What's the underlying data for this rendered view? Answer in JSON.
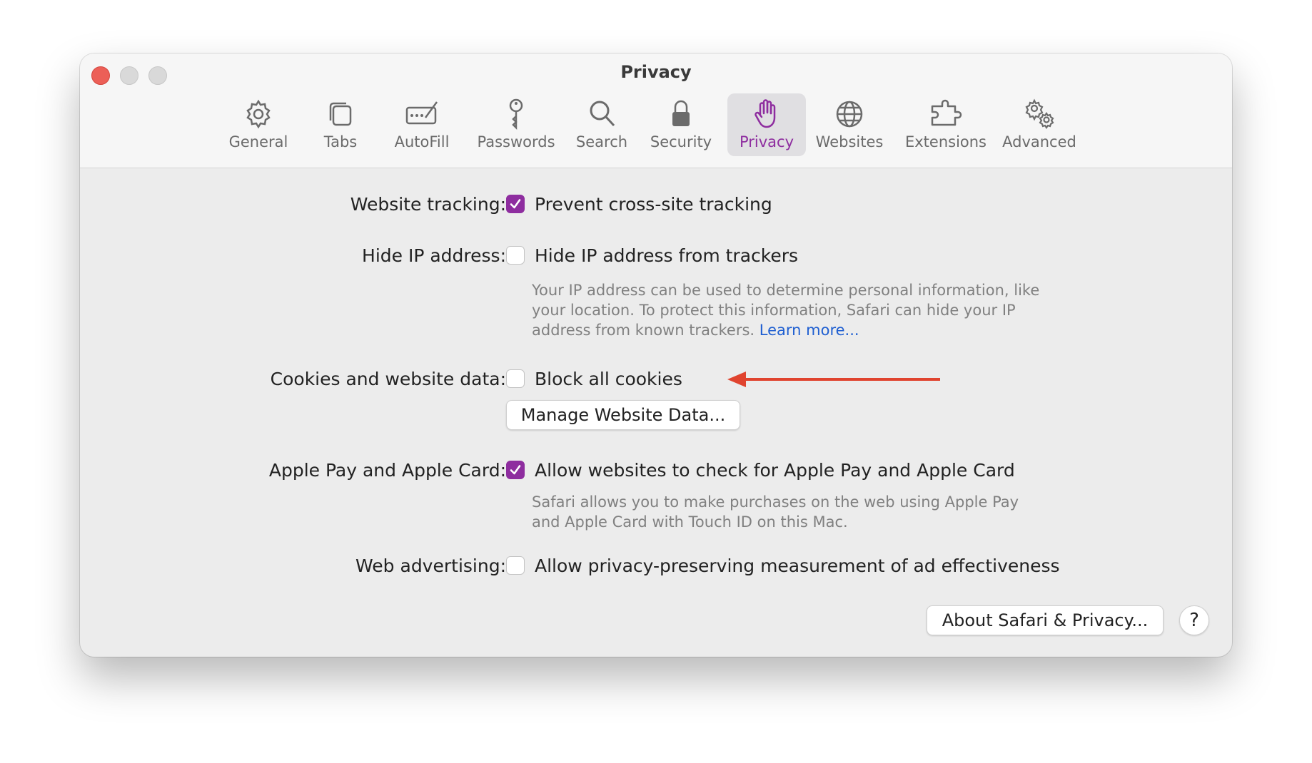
{
  "window": {
    "title": "Privacy"
  },
  "toolbar": {
    "items": [
      {
        "label": "General",
        "icon": "gear-icon"
      },
      {
        "label": "Tabs",
        "icon": "tabs-icon"
      },
      {
        "label": "AutoFill",
        "icon": "autofill-icon"
      },
      {
        "label": "Passwords",
        "icon": "key-icon"
      },
      {
        "label": "Search",
        "icon": "search-icon"
      },
      {
        "label": "Security",
        "icon": "lock-icon"
      },
      {
        "label": "Privacy",
        "icon": "hand-icon",
        "active": true
      },
      {
        "label": "Websites",
        "icon": "globe-icon"
      },
      {
        "label": "Extensions",
        "icon": "puzzle-icon"
      },
      {
        "label": "Advanced",
        "icon": "gears-icon"
      }
    ]
  },
  "settings": {
    "tracking": {
      "label": "Website tracking:",
      "option": "Prevent cross-site tracking",
      "checked": true
    },
    "hide_ip": {
      "label": "Hide IP address:",
      "option": "Hide IP address from trackers",
      "checked": false,
      "help_line1": "Your IP address can be used to determine personal information, like",
      "help_line2": "your location. To protect this information, Safari can hide your IP",
      "help_line3": "address from known trackers.",
      "learn_more": "Learn more..."
    },
    "cookies": {
      "label": "Cookies and website data:",
      "option": "Block all cookies",
      "checked": false,
      "button": "Manage Website Data..."
    },
    "apple_pay": {
      "label": "Apple Pay and Apple Card:",
      "option": "Allow websites to check for Apple Pay and Apple Card",
      "checked": true,
      "help_line1": "Safari allows you to make purchases on the web using Apple Pay",
      "help_line2": "and Apple Card with Touch ID on this Mac."
    },
    "web_ads": {
      "label": "Web advertising:",
      "option": "Allow privacy-preserving measurement of ad effectiveness",
      "checked": false
    }
  },
  "footer": {
    "about_button": "About Safari & Privacy...",
    "help_button": "?"
  },
  "colors": {
    "accent": "#8e2d9f",
    "arrow": "#e0442f",
    "link": "#1f5fd1"
  }
}
